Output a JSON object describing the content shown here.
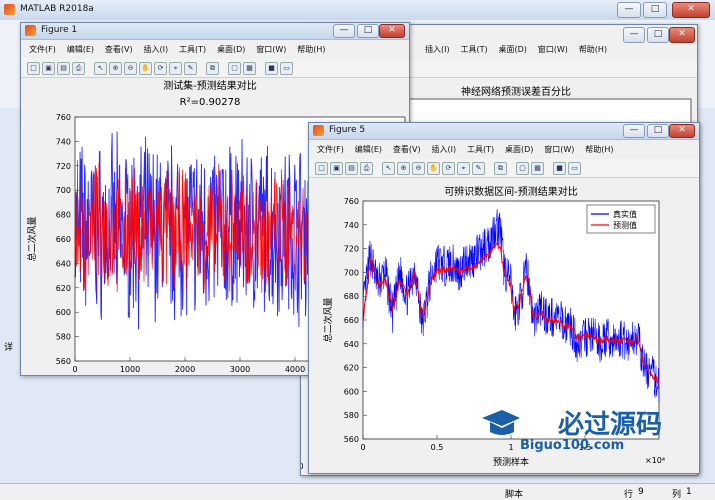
{
  "app": {
    "title": "MATLAB R2018a",
    "status_label": "脚本",
    "row_label": "行",
    "row_value": "9",
    "col_label": "列",
    "col_value": "1"
  },
  "menus": [
    "文件(F)",
    "编辑(E)",
    "查看(V)",
    "插入(I)",
    "工具(T)",
    "桌面(D)",
    "窗口(W)",
    "帮助(H)"
  ],
  "window_buttons": {
    "minimize": "—",
    "maximize": "□",
    "close": "✕"
  },
  "figure1": {
    "title": "Figure 1",
    "chart_data": {
      "type": "scatter",
      "title": "测试集-预测结果对比",
      "subtitle": "R²=0.90278",
      "xlabel": "预测样本",
      "ylabel": "总二次风量",
      "xlim": [
        0,
        6000
      ],
      "ylim": [
        560,
        760
      ],
      "xticks": [
        "0",
        "1000",
        "2000",
        "3000",
        "4000",
        "5000"
      ],
      "yticks": [
        "560",
        "580",
        "600",
        "620",
        "640",
        "660",
        "680",
        "700",
        "720",
        "740",
        "760"
      ],
      "series": [
        {
          "color": "#0000ff",
          "marker": "star",
          "values_range": [
            585,
            750
          ]
        },
        {
          "color": "#ff0000",
          "marker": "circle",
          "values_range": [
            610,
            725
          ]
        }
      ]
    }
  },
  "figure_back": {
    "chart_data": {
      "type": "line",
      "title": "神经网络预测误差百分比",
      "xlabel": "预测样本",
      "xticks": [
        "0",
        "0.5",
        "1",
        "1.5",
        "2"
      ],
      "yticks": [
        "650",
        "640"
      ]
    },
    "side_label": "详"
  },
  "figure5": {
    "title": "Figure 5",
    "chart_data": {
      "type": "line",
      "title": "可辨识数据区间-预测结果对比",
      "xlabel": "预测样本",
      "ylabel": "总二次风量",
      "xlim": [
        0,
        2
      ],
      "ylim": [
        560,
        760
      ],
      "x_exponent": "×10⁴",
      "xticks": [
        "0",
        "0.5",
        "1",
        "1.5"
      ],
      "yticks": [
        "560",
        "580",
        "600",
        "620",
        "640",
        "660",
        "680",
        "700",
        "720",
        "740",
        "760"
      ],
      "legend": [
        "真实值",
        "预测值"
      ],
      "legend_position": "top-right",
      "series": [
        {
          "name": "真实值",
          "color": "#0000ff",
          "x": [
            0,
            0.05,
            0.1,
            0.15,
            0.2,
            0.25,
            0.3,
            0.35,
            0.4,
            0.45,
            0.5,
            0.55,
            0.6,
            0.65,
            0.7,
            0.75,
            0.8,
            0.85,
            0.9,
            0.93,
            0.95,
            1.0,
            1.02,
            1.05,
            1.1,
            1.12,
            1.15,
            1.2,
            1.25,
            1.3,
            1.35,
            1.4,
            1.45,
            1.5,
            1.55,
            1.6,
            1.65,
            1.7,
            1.75,
            1.8,
            1.85,
            1.9,
            1.95,
            2.0
          ],
          "values": [
            670,
            715,
            690,
            700,
            665,
            700,
            680,
            705,
            655,
            690,
            710,
            705,
            708,
            700,
            710,
            712,
            718,
            725,
            740,
            735,
            705,
            690,
            665,
            670,
            700,
            695,
            660,
            670,
            662,
            662,
            658,
            655,
            640,
            645,
            648,
            640,
            645,
            640,
            645,
            640,
            648,
            620,
            615,
            605
          ]
        },
        {
          "name": "预测值",
          "color": "#ff0000",
          "x": [
            0,
            0.05,
            0.1,
            0.15,
            0.2,
            0.25,
            0.3,
            0.35,
            0.4,
            0.45,
            0.5,
            0.55,
            0.6,
            0.65,
            0.7,
            0.75,
            0.8,
            0.85,
            0.9,
            0.93,
            0.95,
            1.0,
            1.02,
            1.05,
            1.1,
            1.12,
            1.15,
            1.2,
            1.25,
            1.3,
            1.35,
            1.4,
            1.45,
            1.5,
            1.55,
            1.6,
            1.65,
            1.7,
            1.75,
            1.8,
            1.85,
            1.9,
            1.95,
            2.0
          ],
          "values": [
            660,
            710,
            688,
            695,
            668,
            695,
            680,
            700,
            660,
            688,
            702,
            702,
            704,
            700,
            703,
            705,
            710,
            715,
            725,
            720,
            702,
            688,
            668,
            672,
            698,
            692,
            662,
            665,
            660,
            660,
            656,
            654,
            645,
            646,
            646,
            642,
            644,
            642,
            643,
            641,
            645,
            622,
            615,
            608
          ]
        }
      ]
    }
  },
  "watermark": {
    "text": "必过源码",
    "url_text": "Biguo100.com"
  }
}
